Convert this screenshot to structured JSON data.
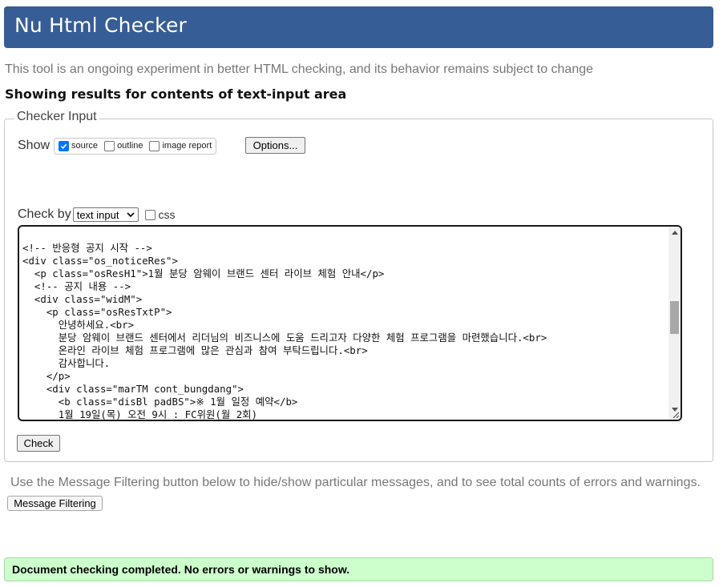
{
  "header": {
    "title": "Nu Html Checker"
  },
  "tagline": "This tool is an ongoing experiment in better HTML checking, and its behavior remains subject to change",
  "results_heading": "Showing results for contents of text-input area",
  "checker_input": {
    "legend": "Checker Input",
    "show_label": "Show",
    "show_options": [
      {
        "label": "source",
        "checked": true
      },
      {
        "label": "outline",
        "checked": false
      },
      {
        "label": "image report",
        "checked": false
      }
    ],
    "options_button": "Options...",
    "check_by_label": "Check by",
    "check_by_select": "text input",
    "css_label": "css",
    "css_checked": false,
    "code_lines": [
      "<!-- 반응형 공지 시작 -->",
      "<div class=\"os_noticeRes\">",
      "  <p class=\"osResH1\">1월 분당 암웨이 브랜드 센터 라이브 체험 안내</p>",
      "  <!-- 공지 내용 -->",
      "  <div class=\"widM\">",
      "    <p class=\"osResTxtP\">",
      "      안녕하세요.<br>",
      "      분당 암웨이 브랜드 센터에서 리더님의 비즈니스에 도움 드리고자 다양한 체험 프로그램을 마련했습니다.<br>",
      "      온라인 라이브 체험 프로그램에 많은 관심과 참여 부탁드립니다.<br>",
      "      감사합니다.",
      "    </p>",
      "    <div class=\"marTM cont_bungdang\">",
      "      <b class=\"disBl padBS\">※ 1월 일정 예약</b>",
      "      1월 19일(목) 오전 9시 : FC위원(월 2회)"
    ],
    "check_button": "Check"
  },
  "filter_note": "Use the Message Filtering button below to hide/show particular messages, and to see total counts of errors and warnings.",
  "filter_button": "Message Filtering",
  "status_message": "Document checking completed. No errors or warnings to show.",
  "colors": {
    "header_bg": "#365d95",
    "success_bg": "#ccffcc",
    "checkbox_checked": "#0075ff"
  }
}
